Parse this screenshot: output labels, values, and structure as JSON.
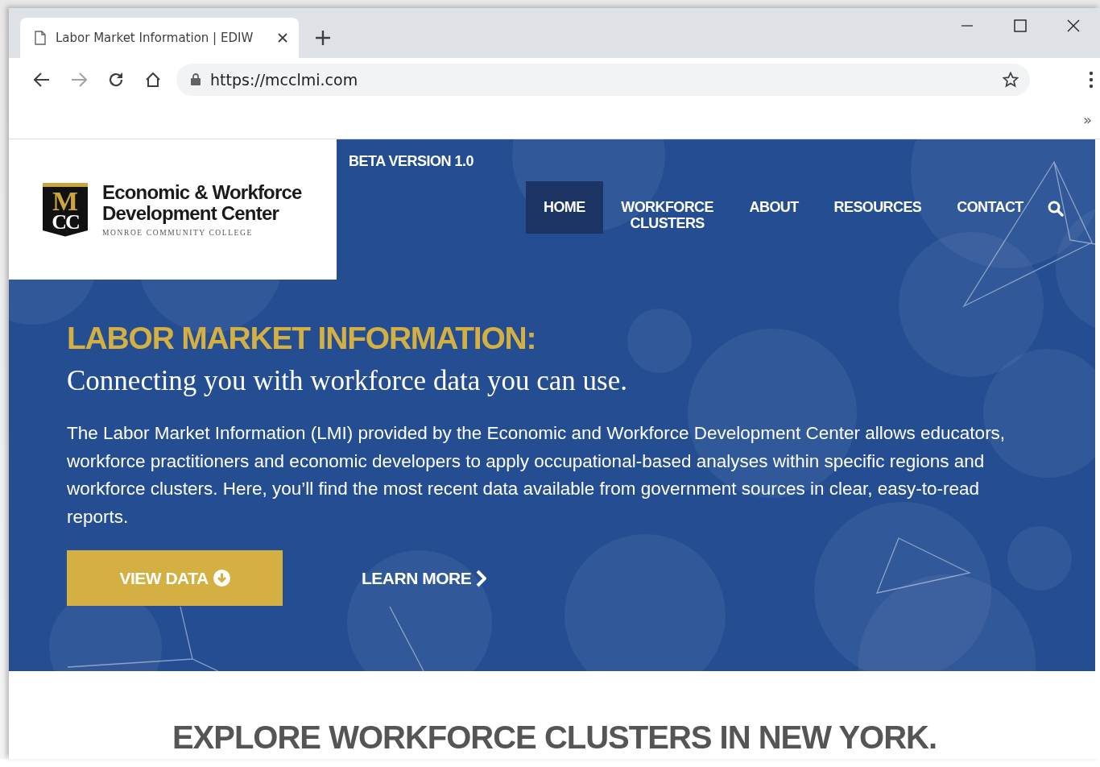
{
  "browser": {
    "tabs": [
      {
        "title": "Labor Market Information | EDIW",
        "selected": true
      }
    ],
    "url": "https://mcclmi.com",
    "bookmarks_overflow": "»"
  },
  "header": {
    "logo": {
      "monogram_top": "M",
      "monogram_bottom": "CC",
      "name_line_1": "Economic & Workforce",
      "name_line_2": "Development Center",
      "tagline": "MONROE COMMUNITY COLLEGE"
    },
    "version": "BETA VERSION 1.0",
    "nav": [
      {
        "label": "HOME",
        "selected": true
      },
      {
        "label": "WORKFORCE CLUSTERS",
        "selected": false
      },
      {
        "label": "ABOUT",
        "selected": false
      },
      {
        "label": "RESOURCES",
        "selected": false
      },
      {
        "label": "CONTACT",
        "selected": false
      }
    ]
  },
  "hero": {
    "heading": "LABOR MARKET INFORMATION:",
    "subheading": "Connecting you with workforce data you can use.",
    "body": "The Labor Market Information (LMI) provided by the Economic and Workforce Development Center allows educators, workforce practitioners and economic developers to apply occupational-based analyses within specific regions and workforce clusters. Here, you’ll find the most recent data available from government sources in clear, easy-to-read reports.",
    "buttons": [
      {
        "label": "VIEW DATA",
        "kind": "primary"
      },
      {
        "label": "LEARN MORE",
        "kind": "link"
      }
    ]
  },
  "section_heading": "EXPLORE WORKFORCE CLUSTERS IN NEW YORK."
}
